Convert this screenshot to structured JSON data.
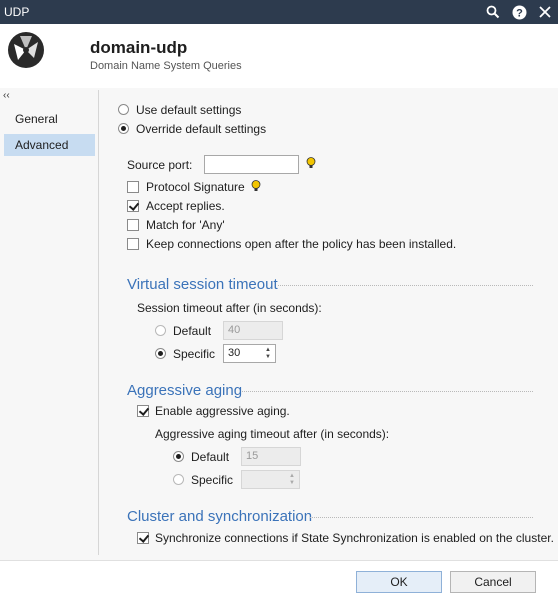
{
  "window": {
    "title": "UDP"
  },
  "header": {
    "name": "domain-udp",
    "description": "Domain Name System Queries"
  },
  "nav": {
    "items": [
      {
        "label": "General",
        "active": false
      },
      {
        "label": "Advanced",
        "active": true
      }
    ]
  },
  "settings_mode": {
    "use_default": "Use default settings",
    "override": "Override default settings",
    "selected": "override"
  },
  "general": {
    "source_port_label": "Source port:",
    "source_port_value": "",
    "protocol_signature": {
      "label": "Protocol Signature",
      "checked": false
    },
    "accept_replies": {
      "label": "Accept replies.",
      "checked": true
    },
    "match_any": {
      "label": "Match for 'Any'",
      "checked": false
    },
    "keep_connections": {
      "label": "Keep connections open after the policy has been installed.",
      "checked": false
    }
  },
  "virtual_session": {
    "title": "Virtual session timeout",
    "timeout_label": "Session timeout after (in seconds):",
    "default_label": "Default",
    "default_value": "40",
    "specific_label": "Specific",
    "specific_value": "30",
    "selected": "specific"
  },
  "aggressive_aging": {
    "title": "Aggressive aging",
    "enable_label": "Enable aggressive aging.",
    "enabled": true,
    "timeout_label": "Aggressive aging timeout after (in seconds):",
    "default_label": "Default",
    "default_value": "15",
    "specific_label": "Specific",
    "specific_value": "",
    "selected": "default"
  },
  "cluster": {
    "title": "Cluster and synchronization",
    "sync_label": "Synchronize connections if State Synchronization is enabled on the cluster.",
    "sync_checked": true
  },
  "buttons": {
    "ok": "OK",
    "cancel": "Cancel"
  },
  "colors": {
    "titlebar": "#2d3b4e",
    "accent": "#3b73b9",
    "nav_active": "#c7dcf1",
    "tip_icon": "#f2c500"
  }
}
